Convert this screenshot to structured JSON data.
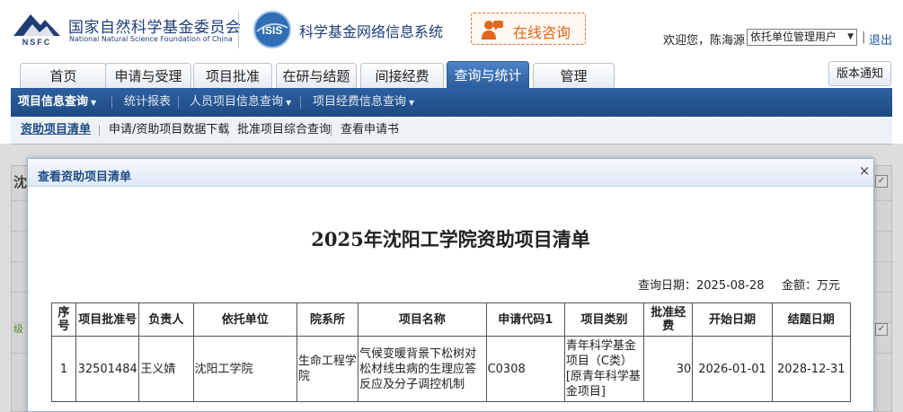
{
  "header": {
    "org_name_cn": "国家自然科学基金委员会",
    "org_name_en": "National Natural Science Foundation of China",
    "logo_text": "NSFC",
    "isis_logo_text": "ISIS",
    "system_title": "科学基金网络信息系统",
    "consult_label": "在线咨询",
    "welcome_text": "欢迎您，陈海源",
    "role_selected": "依托单位管理用户",
    "logout_label": "退出"
  },
  "tabs": [
    {
      "label": "首页",
      "active": false
    },
    {
      "label": "申请与受理",
      "active": false
    },
    {
      "label": "项目批准",
      "active": false
    },
    {
      "label": "在研与结题",
      "active": false
    },
    {
      "label": "间接经费",
      "active": false
    },
    {
      "label": "查询与统计",
      "active": true
    },
    {
      "label": "管理",
      "active": false
    }
  ],
  "notice_label": "版本通知",
  "subnav": [
    {
      "label": "项目信息查询",
      "dropdown": true,
      "active": true
    },
    {
      "label": "统计报表",
      "dropdown": false,
      "active": false
    },
    {
      "label": "人员项目信息查询",
      "dropdown": true,
      "active": false
    },
    {
      "label": "项目经费信息查询",
      "dropdown": true,
      "active": false
    }
  ],
  "thirdnav": [
    {
      "label": "资助项目清单",
      "active": true
    },
    {
      "label": "申请/资助项目数据下载",
      "active": false
    },
    {
      "label": "批准项目综合查询",
      "active": false
    },
    {
      "label": "查看申请书",
      "active": false
    }
  ],
  "background": {
    "letter": "沈",
    "green_char": "级"
  },
  "dialog": {
    "title": "查看资助项目清单",
    "close_glyph": "×",
    "report_title": "2025年沈阳工学院资助项目清单",
    "query_date_label": "查询日期：",
    "query_date": "2025-08-28",
    "amount_unit_label": "金额：万元",
    "columns": [
      "序号",
      "项目批准号",
      "负责人",
      "依托单位",
      "院系所",
      "项目名称",
      "申请代码1",
      "项目类别",
      "批准经费",
      "开始日期",
      "结题日期"
    ],
    "rows": [
      {
        "seq": "1",
        "approval_no": "32501484",
        "leader": "王义婧",
        "institution": "沈阳工学院",
        "department": "生命工程学院",
        "project_name": "气候变暖背景下松树对松材线虫病的生理应答反应及分子调控机制",
        "code": "C0308",
        "category": "青年科学基金项目（C类）[原青年科学基金项目]",
        "funding": "30",
        "start_date": "2026-01-01",
        "end_date": "2028-12-31"
      }
    ]
  },
  "colors": {
    "brand_blue": "#1e4b85",
    "accent_orange": "#e0661c",
    "active_tab": "#2b5d9c"
  }
}
